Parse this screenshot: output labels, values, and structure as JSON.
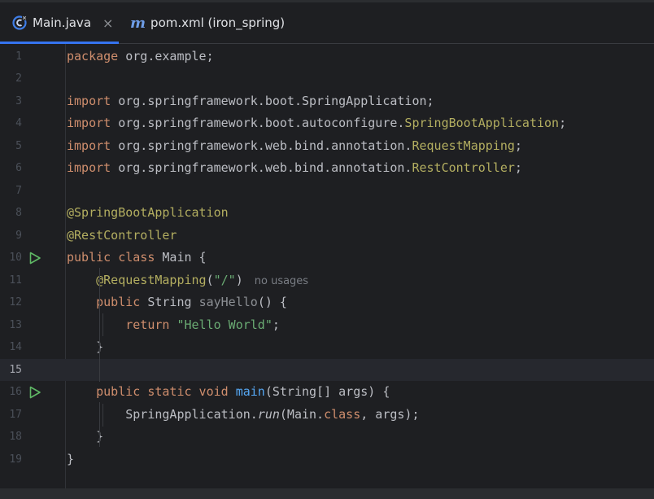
{
  "tabs": [
    {
      "label": "Main.java",
      "icon": "java-class-icon",
      "active": true,
      "close": "×"
    },
    {
      "label": "pom.xml (iron_spring)",
      "icon": "maven-icon",
      "icon_glyph": "m",
      "active": false
    }
  ],
  "lines": {
    "n1": "1",
    "n2": "2",
    "n3": "3",
    "n4": "4",
    "n5": "5",
    "n6": "6",
    "n7": "7",
    "n8": "8",
    "n9": "9",
    "n10": "10",
    "n11": "11",
    "n12": "12",
    "n13": "13",
    "n14": "14",
    "n15": "15",
    "n16": "16",
    "n17": "17",
    "n18": "18",
    "n19": "19"
  },
  "code": {
    "l1": {
      "kw": "package",
      "rest": " org.example;"
    },
    "l3": {
      "kw": "import",
      "rest": " org.springframework.boot.SpringApplication;"
    },
    "l4": {
      "kw": "import",
      "pkg": " org.springframework.boot.autoconfigure.",
      "cls": "SpringBootApplication",
      "end": ";"
    },
    "l5": {
      "kw": "import",
      "pkg": " org.springframework.web.bind.annotation.",
      "cls": "RequestMapping",
      "end": ";"
    },
    "l6": {
      "kw": "import",
      "pkg": " org.springframework.web.bind.annotation.",
      "cls": "RestController",
      "end": ";"
    },
    "l8": {
      "ann": "@SpringBootApplication"
    },
    "l9": {
      "ann": "@RestController"
    },
    "l10": {
      "kw": "public class",
      "rest": " Main {"
    },
    "l11": {
      "indent": "    ",
      "ann": "@RequestMapping",
      "open": "(",
      "str": "\"/\"",
      "close": ")",
      "hint": "no usages"
    },
    "l12": {
      "indent": "    ",
      "kw": "public",
      "type": " String ",
      "name": "sayHello",
      "rest": "() {"
    },
    "l13": {
      "indent": "        ",
      "kw": "return",
      "sp": " ",
      "str": "\"Hello World\"",
      "end": ";"
    },
    "l14": {
      "text": "    }"
    },
    "l16": {
      "indent": "    ",
      "kw": "public static void",
      "sp": " ",
      "fn": "main",
      "rest": "(String[] args) {"
    },
    "l17": {
      "indent": "        ",
      "pre": "SpringApplication.",
      "it": "run",
      "mid": "(Main.",
      "kw": "class",
      "end": ", args);"
    },
    "l18": {
      "text": "    }"
    },
    "l19": {
      "text": "}"
    }
  },
  "colors": {
    "keyword": "#cf8e6d",
    "annotation": "#b3ae60",
    "string": "#6aab73",
    "function": "#56a8f5",
    "run_gutter": "#5fb865",
    "active_tab_underline": "#3574f0"
  }
}
